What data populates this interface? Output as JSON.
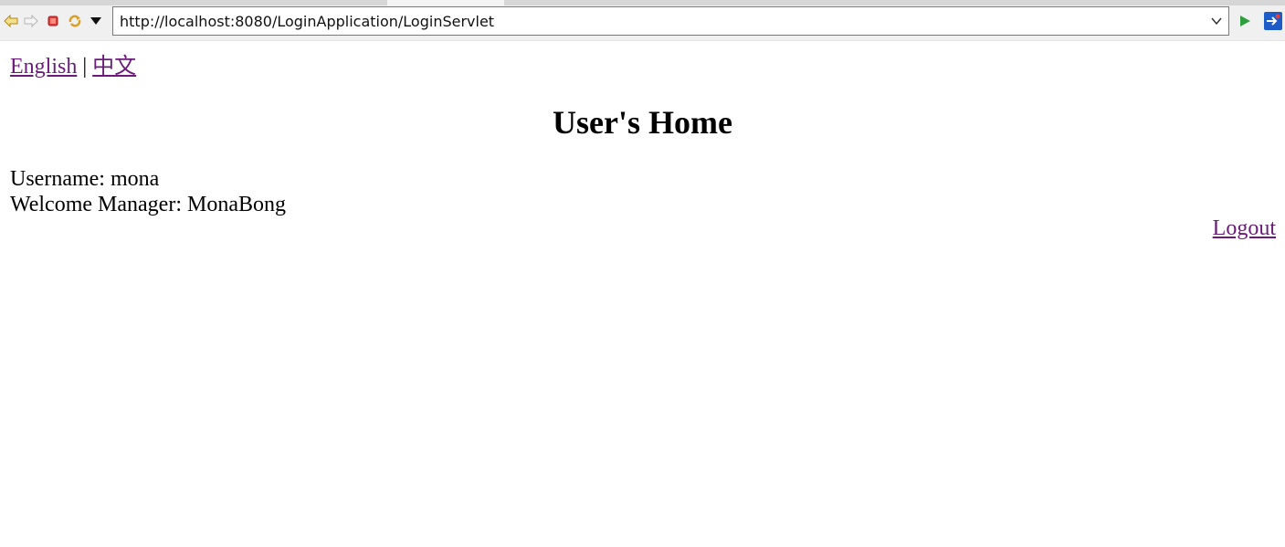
{
  "browser": {
    "url": "http://localhost:8080/LoginApplication/LoginServlet",
    "icons": [
      "back-icon",
      "forward-icon",
      "stop-icon",
      "refresh-icon",
      "menu-dropdown-icon",
      "chevron-down-icon",
      "go-icon",
      "external-browser-icon"
    ]
  },
  "language": {
    "english": "English",
    "separator": "|",
    "chinese": "中文"
  },
  "title": "User's Home",
  "user": {
    "username_line": "Username: mona",
    "welcome_line": "Welcome Manager: MonaBong"
  },
  "logout_label": "Logout",
  "colors": {
    "link": "#6a1b7a",
    "toolbar_bg": "#f0f0f0"
  }
}
